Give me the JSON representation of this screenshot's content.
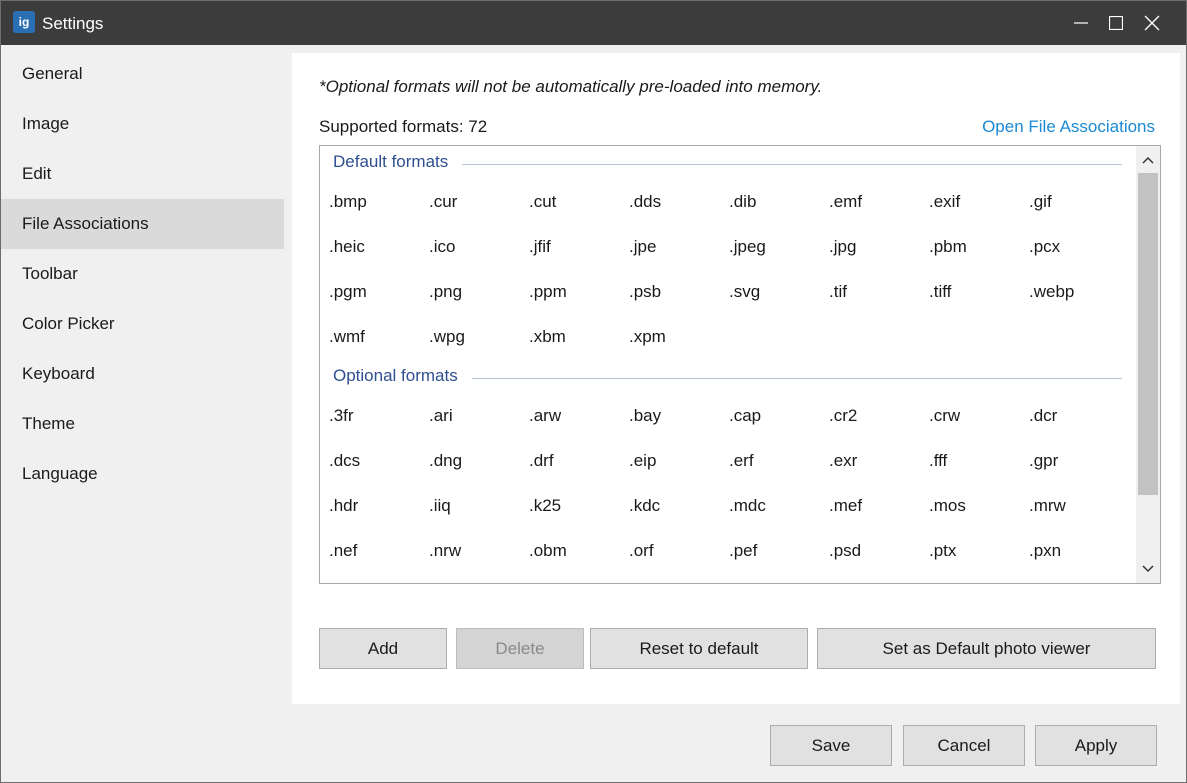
{
  "window": {
    "title": "Settings",
    "app_icon_glyph": "ig"
  },
  "sidebar": {
    "items": [
      {
        "label": "General"
      },
      {
        "label": "Image"
      },
      {
        "label": "Edit"
      },
      {
        "label": "File Associations",
        "active": true
      },
      {
        "label": "Toolbar"
      },
      {
        "label": "Color Picker"
      },
      {
        "label": "Keyboard"
      },
      {
        "label": "Theme"
      },
      {
        "label": "Language"
      }
    ]
  },
  "main": {
    "note": "*Optional formats will not be automatically pre-loaded into memory.",
    "supported_label": "Supported formats: 72",
    "open_link": "Open File Associations",
    "default_header": "Default formats",
    "optional_header": "Optional formats",
    "default_formats": [
      ".bmp",
      ".cur",
      ".cut",
      ".dds",
      ".dib",
      ".emf",
      ".exif",
      ".gif",
      ".heic",
      ".ico",
      ".jfif",
      ".jpe",
      ".jpeg",
      ".jpg",
      ".pbm",
      ".pcx",
      ".pgm",
      ".png",
      ".ppm",
      ".psb",
      ".svg",
      ".tif",
      ".tiff",
      ".webp",
      ".wmf",
      ".wpg",
      ".xbm",
      ".xpm"
    ],
    "optional_formats": [
      ".3fr",
      ".ari",
      ".arw",
      ".bay",
      ".cap",
      ".cr2",
      ".crw",
      ".dcr",
      ".dcs",
      ".dng",
      ".drf",
      ".eip",
      ".erf",
      ".exr",
      ".fff",
      ".gpr",
      ".hdr",
      ".iiq",
      ".k25",
      ".kdc",
      ".mdc",
      ".mef",
      ".mos",
      ".mrw",
      ".nef",
      ".nrw",
      ".obm",
      ".orf",
      ".pef",
      ".psd",
      ".ptx",
      ".pxn"
    ],
    "buttons": {
      "add": "Add",
      "delete": "Delete",
      "reset": "Reset to default",
      "set_default": "Set as Default photo viewer"
    }
  },
  "footer": {
    "save": "Save",
    "cancel": "Cancel",
    "apply": "Apply"
  },
  "colors": {
    "link": "#1a8ad4",
    "group_header": "#2f4f8f",
    "titlebar": "#3c3c3c"
  }
}
